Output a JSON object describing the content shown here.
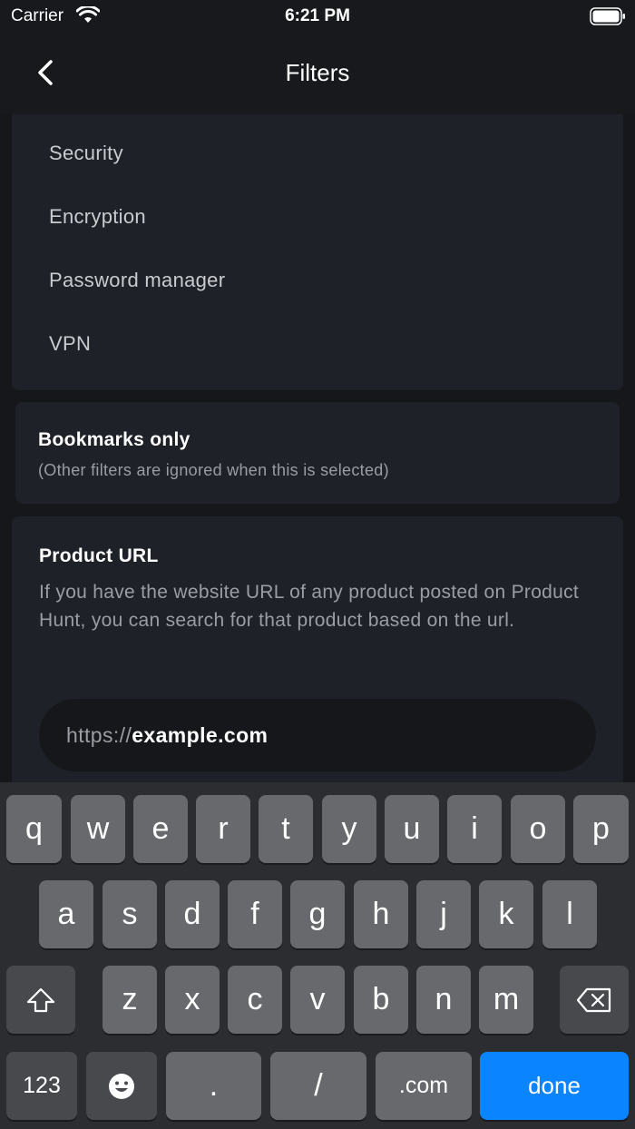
{
  "status_bar": {
    "carrier": "Carrier",
    "time": "6:21 PM"
  },
  "nav": {
    "title": "Filters"
  },
  "categories": [
    "Security",
    "Encryption",
    "Password manager",
    "VPN"
  ],
  "bookmarks": {
    "title": "Bookmarks only",
    "subtitle": "(Other filters are ignored when this is selected)"
  },
  "product_url": {
    "title": "Product URL",
    "description": "If you have the website URL of any product posted on Product Hunt, you can search for that product based on the url.",
    "prefix": "https://",
    "value": "example.com"
  },
  "keyboard": {
    "row1": [
      "q",
      "w",
      "e",
      "r",
      "t",
      "y",
      "u",
      "i",
      "o",
      "p"
    ],
    "row2": [
      "a",
      "s",
      "d",
      "f",
      "g",
      "h",
      "j",
      "k",
      "l"
    ],
    "row3": [
      "z",
      "x",
      "c",
      "v",
      "b",
      "n",
      "m"
    ],
    "numbers_label": "123",
    "period_label": ".",
    "slash_label": "/",
    "dotcom_label": ".com",
    "done_label": "done"
  },
  "colors": {
    "accent": "#0a84ff",
    "background": "#15171b",
    "card": "#1e2127"
  }
}
